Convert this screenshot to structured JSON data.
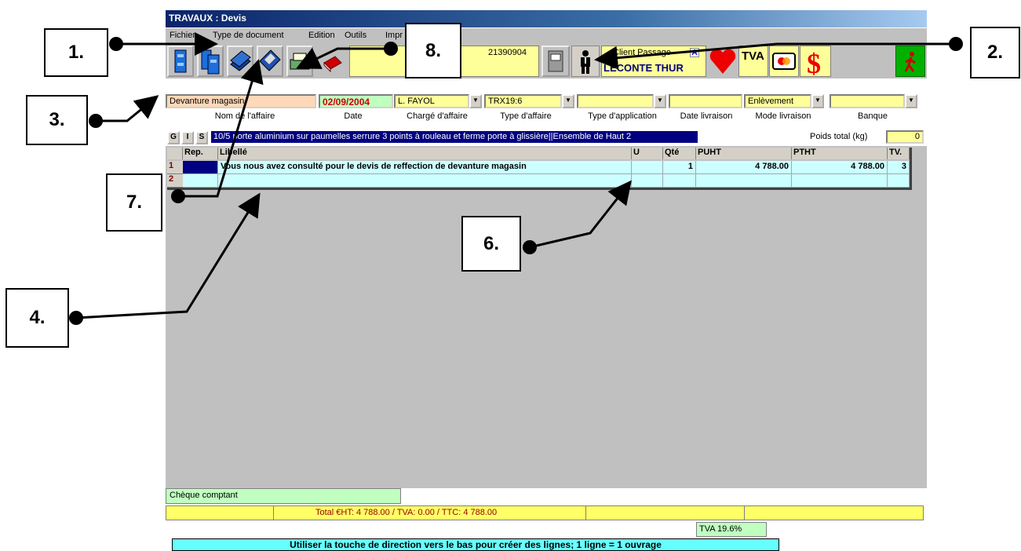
{
  "window": {
    "title": "TRAVAUX : Devis"
  },
  "menu": [
    "Fichier",
    "Type de document",
    "Edition",
    "Outils",
    "Impr"
  ],
  "toolbar": {
    "doc_number": "21390904",
    "client_line1": "Client Passage",
    "client_badge": "A",
    "client_line2": "LECONTE THUR",
    "tva_label": "TVA",
    "icons": [
      "cabinet-icon",
      "cabinets-icon",
      "books-icon",
      "floppy-disk-icon",
      "cash-register-icon",
      "book-icon",
      "notepad-icon",
      "person-icon",
      "heart-icon",
      "tva-icon",
      "credit-card-icon",
      "dollar-icon",
      "exit-icon"
    ]
  },
  "form": {
    "nom_affaire": "Devanture magasin",
    "date": "02/09/2004",
    "charge": "L. FAYOL",
    "type_affaire": "TRX19:6",
    "type_application": "",
    "date_livraison": "",
    "mode_livraison": "Enlèvement",
    "banque": "",
    "labels": {
      "nom_affaire": "Nom de l'affaire",
      "date": "Date",
      "charge": "Chargé d'affaire",
      "type_affaire": "Type d'affaire",
      "type_application": "Type d'application",
      "date_livraison": "Date livraison",
      "mode_livraison": "Mode livraison",
      "banque": "Banque"
    }
  },
  "gis_buttons": [
    "G",
    "I",
    "S"
  ],
  "ouvrage_bar": "10/5 porte aluminium sur paumelles serrure 3 points à rouleau et ferme porte à glissière||Ensemble de Haut 2",
  "poids": {
    "label": "Poids total (kg)",
    "value": "0"
  },
  "table": {
    "headers": [
      "Rep.",
      "Libellé",
      "U",
      "Qté",
      "PUHT",
      "PTHT",
      "TV."
    ],
    "rows": [
      {
        "num": "1",
        "rep": "",
        "libelle": "Vous nous avez consulté pour le devis de reffection de devanture magasin",
        "u": "",
        "qte": "1",
        "puht": "4 788.00",
        "ptht": "4 788.00",
        "tva": "3"
      },
      {
        "num": "2",
        "rep": "",
        "libelle": "",
        "u": "",
        "qte": "",
        "puht": "",
        "ptht": "",
        "tva": ""
      }
    ]
  },
  "footer": {
    "payment": "Chèque comptant",
    "totals": "Total €HT: 4 788.00 / TVA:  0.00 / TTC: 4 788.00",
    "tva_rate": "TVA 19.6%",
    "hint": "Utiliser la touche de direction vers le bas pour créer des lignes; 1 ligne = 1 ouvrage"
  },
  "callouts": [
    "1.",
    "2.",
    "3.",
    "4.",
    "6.",
    "7.",
    "8."
  ]
}
